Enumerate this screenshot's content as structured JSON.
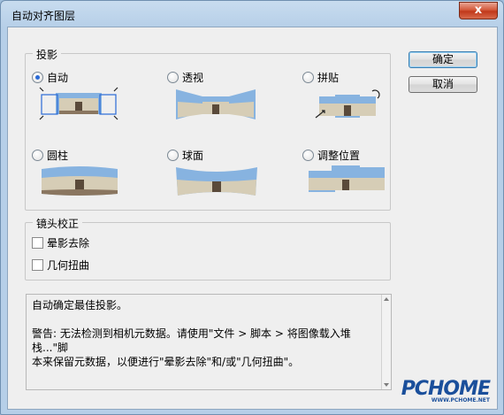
{
  "window": {
    "title": "自动对齐图层",
    "close_glyph": "x"
  },
  "projection": {
    "legend": "投影",
    "options": [
      {
        "label": "自动",
        "checked": true
      },
      {
        "label": "透视",
        "checked": false
      },
      {
        "label": "拼贴",
        "checked": false
      },
      {
        "label": "圆柱",
        "checked": false
      },
      {
        "label": "球面",
        "checked": false
      },
      {
        "label": "调整位置",
        "checked": false
      }
    ]
  },
  "lens": {
    "legend": "镜头校正",
    "options": [
      {
        "label": "晕影去除",
        "checked": false
      },
      {
        "label": "几何扭曲",
        "checked": false
      }
    ]
  },
  "buttons": {
    "ok": "确定",
    "cancel": "取消"
  },
  "description": {
    "line1": "自动确定最佳投影。",
    "line2": "警告: 无法检测到相机元数据。请使用\"文件 > 脚本 > 将图像载入堆栈...\"脚",
    "line3": "本来保留元数据，以便进行\"晕影去除\"和/或\"几何扭曲\"。"
  },
  "watermark": {
    "brand": "PCHOME",
    "sub": "WWW.PCHOME.NET"
  },
  "colors": {
    "accent": "#3c7fb1",
    "radio_dot": "#2a6ad6",
    "close": "#c0391b"
  }
}
